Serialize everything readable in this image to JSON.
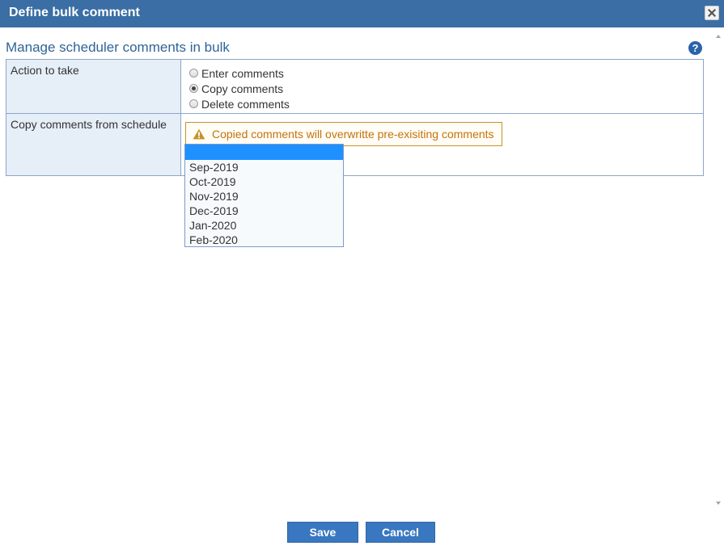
{
  "window": {
    "title": "Define bulk comment",
    "close_icon": "close-icon"
  },
  "main": {
    "heading": "Manage scheduler comments in bulk",
    "help_icon": "?"
  },
  "form": {
    "action_row": {
      "label": "Action to take",
      "options": [
        {
          "label": "Enter comments",
          "checked": false
        },
        {
          "label": "Copy comments",
          "checked": true
        },
        {
          "label": "Delete comments",
          "checked": false
        }
      ]
    },
    "copy_row": {
      "label": "Copy comments from schedule",
      "warning": "Copied comments will overwritte pre-exisiting comments",
      "selected_value": "",
      "dropdown_options": [
        "",
        "Sep-2019",
        "Oct-2019",
        "Nov-2019",
        "Dec-2019",
        "Jan-2020",
        "Feb-2020"
      ]
    }
  },
  "footer": {
    "save_label": "Save",
    "cancel_label": "Cancel"
  },
  "colors": {
    "titlebar": "#3a6ea5",
    "accent_button": "#3978c0",
    "heading_text": "#2f6497",
    "warning_text": "#c5720c",
    "label_cell_bg": "#e6eef8",
    "highlight": "#1e90ff"
  }
}
